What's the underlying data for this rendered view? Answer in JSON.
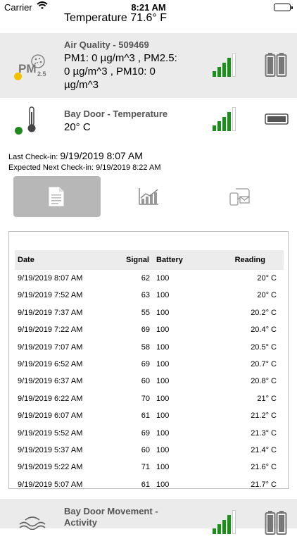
{
  "status_bar": {
    "carrier": "Carrier",
    "time": "8:21 AM"
  },
  "top_reading": "Temperature 71.6° F",
  "sensors": [
    {
      "title": "Air Quality - 509469",
      "reading": "PM1: 0 µg/m^3 , PM2.5: 0 µg/m^3 , PM10: 0 µg/m^3",
      "reading_lines": [
        "PM1: 0 µg/m^3 , PM2.5:",
        "0 µg/m^3 , PM10: 0",
        "µg/m^3"
      ],
      "icon": "pm25-icon",
      "icon_text": "PM",
      "icon_sub": "2.5",
      "status_color": "#f2c200",
      "signal_bars": 4,
      "battery": "battery-full-icon"
    },
    {
      "title": "Bay Door - Temperature",
      "reading": "20° C",
      "icon": "thermometer-icon",
      "status_color": "#1e8a1e",
      "signal_bars": 4,
      "battery": "battery-line-powered-icon"
    },
    {
      "title": "Bay Door Movement - Activity",
      "title_lines": [
        "Bay Door Movement -",
        "Activity"
      ],
      "icon": "motion-waves-icon",
      "signal_bars": 4,
      "battery": "battery-full-icon"
    }
  ],
  "checkin": {
    "last_label": "Last Check-in:",
    "last_value": "9/19/2019 8:07 AM",
    "next_label": "Expected Next Check-in:",
    "next_value": "9/19/2019 8:22 AM"
  },
  "tabs": [
    {
      "icon": "document-icon",
      "active": true
    },
    {
      "icon": "chart-icon",
      "active": false
    },
    {
      "icon": "notification-icon",
      "active": false
    }
  ],
  "table": {
    "headers": {
      "date": "Date",
      "signal": "Signal",
      "battery": "Battery",
      "reading": "Reading"
    },
    "rows": [
      {
        "date": "9/19/2019 8:07 AM",
        "signal": "62",
        "battery": "100",
        "reading": "20° C"
      },
      {
        "date": "9/19/2019 7:52 AM",
        "signal": "63",
        "battery": "100",
        "reading": "20° C"
      },
      {
        "date": "9/19/2019 7:37 AM",
        "signal": "55",
        "battery": "100",
        "reading": "20.2° C"
      },
      {
        "date": "9/19/2019 7:22 AM",
        "signal": "69",
        "battery": "100",
        "reading": "20.4° C"
      },
      {
        "date": "9/19/2019 7:07 AM",
        "signal": "58",
        "battery": "100",
        "reading": "20.5° C"
      },
      {
        "date": "9/19/2019 6:52 AM",
        "signal": "69",
        "battery": "100",
        "reading": "20.7° C"
      },
      {
        "date": "9/19/2019 6:37 AM",
        "signal": "60",
        "battery": "100",
        "reading": "20.8° C"
      },
      {
        "date": "9/19/2019 6:22 AM",
        "signal": "70",
        "battery": "100",
        "reading": "21° C"
      },
      {
        "date": "9/19/2019 6:07 AM",
        "signal": "61",
        "battery": "100",
        "reading": "21.2° C"
      },
      {
        "date": "9/19/2019 5:52 AM",
        "signal": "69",
        "battery": "100",
        "reading": "21.3° C"
      },
      {
        "date": "9/19/2019 5:37 AM",
        "signal": "60",
        "battery": "100",
        "reading": "21.4° C"
      },
      {
        "date": "9/19/2019 5:22 AM",
        "signal": "71",
        "battery": "100",
        "reading": "21.6° C"
      },
      {
        "date": "9/19/2019 5:07 AM",
        "signal": "61",
        "battery": "100",
        "reading": "21.7° C"
      }
    ]
  }
}
